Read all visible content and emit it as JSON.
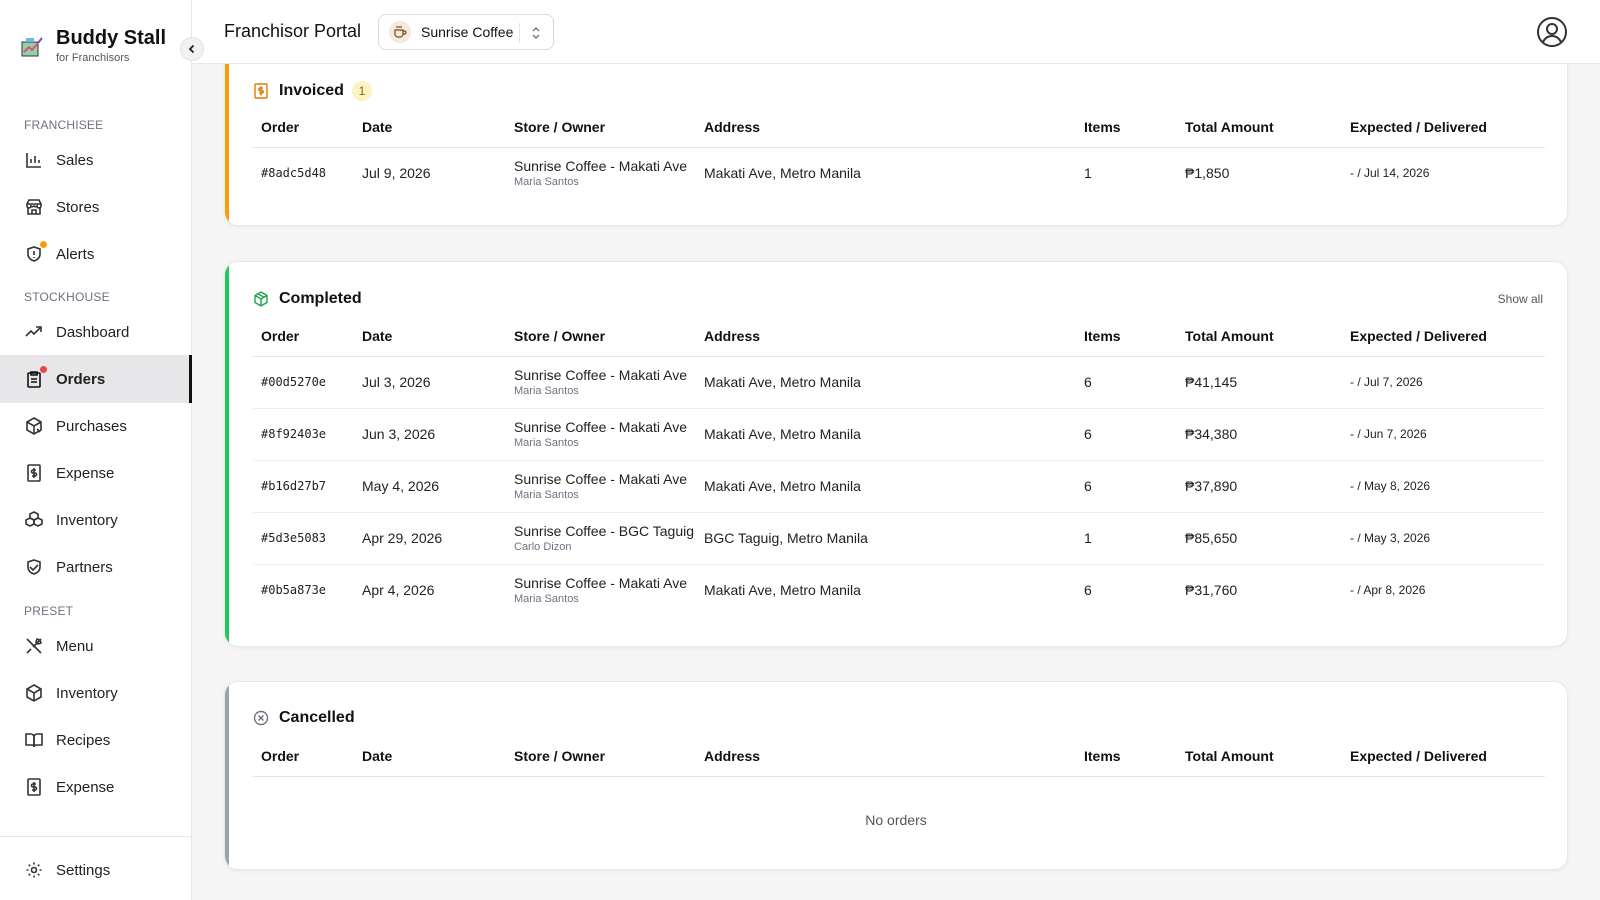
{
  "brand": {
    "title": "Buddy Stall",
    "subtitle": "for Franchisors"
  },
  "sidebar": {
    "sections": [
      {
        "label": "FRANCHISEE"
      },
      {
        "label": "STOCKHOUSE"
      },
      {
        "label": "PRESET"
      }
    ],
    "items": [
      {
        "label": "Sales",
        "icon": "bar-chart-icon"
      },
      {
        "label": "Stores",
        "icon": "store-icon"
      },
      {
        "label": "Alerts",
        "icon": "alert-icon",
        "dot": "#f59e0b"
      },
      {
        "label": "Dashboard",
        "icon": "trending-up-icon"
      },
      {
        "label": "Orders",
        "icon": "clipboard-icon",
        "dot": "#ef4444",
        "active": true
      },
      {
        "label": "Purchases",
        "icon": "package-icon"
      },
      {
        "label": "Expense",
        "icon": "receipt-icon"
      },
      {
        "label": "Inventory",
        "icon": "boxes-icon"
      },
      {
        "label": "Partners",
        "icon": "handshake-icon"
      },
      {
        "label": "Menu",
        "icon": "utensils-icon"
      },
      {
        "label": "Inventory",
        "icon": "box-icon"
      },
      {
        "label": "Recipes",
        "icon": "book-icon"
      },
      {
        "label": "Expense",
        "icon": "receipt-icon"
      },
      {
        "label": "Settings",
        "icon": "gear-icon"
      }
    ]
  },
  "header": {
    "title": "Franchisor Portal",
    "store_selector": "Sunrise Coffee"
  },
  "columns": [
    "Order",
    "Date",
    "Store / Owner",
    "Address",
    "Items",
    "Total Amount",
    "Expected / Delivered"
  ],
  "invoiced": {
    "title": "Invoiced",
    "count": "1",
    "accent": "#f59e0b",
    "rows": [
      {
        "order": "#8adc5d48",
        "date": "Jul 9, 2026",
        "store": "Sunrise Coffee - Makati Ave",
        "owner": "Maria Santos",
        "address": "Makati Ave, Metro Manila",
        "items": "1",
        "total": "₱1,850",
        "expected": "- / Jul 14, 2026"
      }
    ]
  },
  "completed": {
    "title": "Completed",
    "show_all": "Show all",
    "accent": "#22c55e",
    "rows": [
      {
        "order": "#00d5270e",
        "date": "Jul 3, 2026",
        "store": "Sunrise Coffee - Makati Ave",
        "owner": "Maria Santos",
        "address": "Makati Ave, Metro Manila",
        "items": "6",
        "total": "₱41,145",
        "expected": "- / Jul 7, 2026"
      },
      {
        "order": "#8f92403e",
        "date": "Jun 3, 2026",
        "store": "Sunrise Coffee - Makati Ave",
        "owner": "Maria Santos",
        "address": "Makati Ave, Metro Manila",
        "items": "6",
        "total": "₱34,380",
        "expected": "- / Jun 7, 2026"
      },
      {
        "order": "#b16d27b7",
        "date": "May 4, 2026",
        "store": "Sunrise Coffee - Makati Ave",
        "owner": "Maria Santos",
        "address": "Makati Ave, Metro Manila",
        "items": "6",
        "total": "₱37,890",
        "expected": "- / May 8, 2026"
      },
      {
        "order": "#5d3e5083",
        "date": "Apr 29, 2026",
        "store": "Sunrise Coffee - BGC Taguig",
        "owner": "Carlo Dizon",
        "address": "BGC Taguig, Metro Manila",
        "items": "1",
        "total": "₱85,650",
        "expected": "- / May 3, 2026"
      },
      {
        "order": "#0b5a873e",
        "date": "Apr 4, 2026",
        "store": "Sunrise Coffee - Makati Ave",
        "owner": "Maria Santos",
        "address": "Makati Ave, Metro Manila",
        "items": "6",
        "total": "₱31,760",
        "expected": "- / Apr 8, 2026"
      }
    ]
  },
  "cancelled": {
    "title": "Cancelled",
    "accent": "#9ca3af",
    "empty": "No orders"
  }
}
